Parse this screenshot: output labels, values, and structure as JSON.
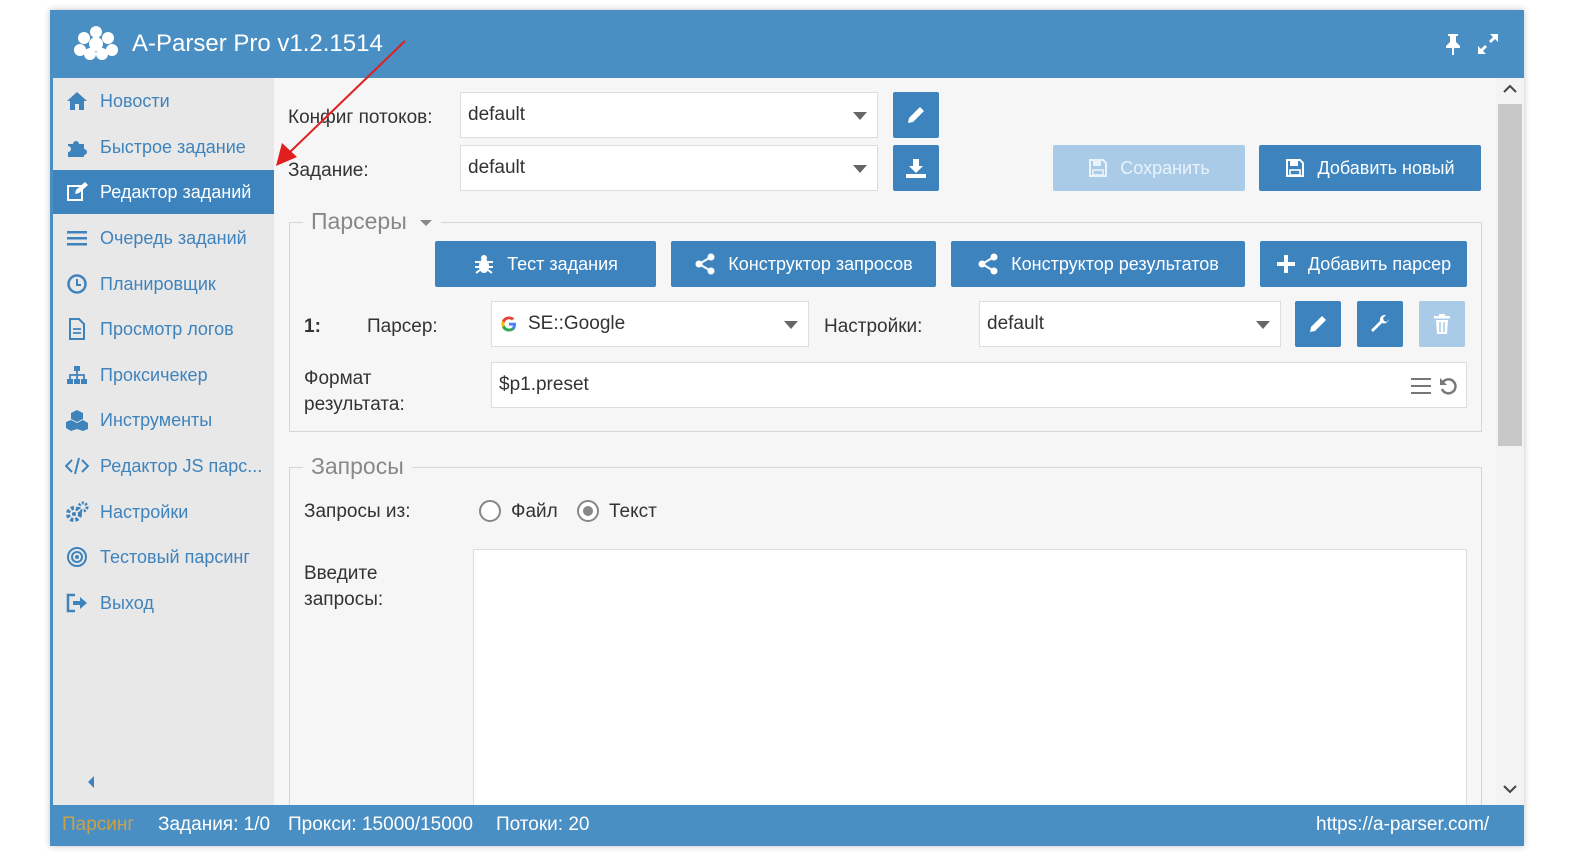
{
  "window": {
    "title": "A-Parser Pro v1.2.1514"
  },
  "sidebar": {
    "items": [
      {
        "label": "Новости",
        "icon": "home-icon"
      },
      {
        "label": "Быстрое задание",
        "icon": "puzzle-icon"
      },
      {
        "label": "Редактор заданий",
        "icon": "edit-icon",
        "active": true
      },
      {
        "label": "Очередь заданий",
        "icon": "list-icon"
      },
      {
        "label": "Планировщик",
        "icon": "clock-icon"
      },
      {
        "label": "Просмотр логов",
        "icon": "file-icon"
      },
      {
        "label": "Проксичекер",
        "icon": "sitemap-icon"
      },
      {
        "label": "Инструменты",
        "icon": "cubes-icon"
      },
      {
        "label": "Редактор JS парс...",
        "icon": "code-icon"
      },
      {
        "label": "Настройки",
        "icon": "gears-icon"
      },
      {
        "label": "Тестовый парсинг",
        "icon": "target-icon"
      },
      {
        "label": "Выход",
        "icon": "sign-out-icon"
      }
    ]
  },
  "form": {
    "threads_config_label": "Конфиг потоков:",
    "threads_config_value": "default",
    "task_label": "Задание:",
    "task_value": "default",
    "save_label": "Сохранить",
    "add_new_label": "Добавить новый"
  },
  "parsers": {
    "legend": "Парсеры",
    "test_task_label": "Тест задания",
    "query_builder_label": "Конструктор запросов",
    "result_builder_label": "Конструктор результатов",
    "add_parser_label": "Добавить парсер",
    "row_index": "1:",
    "parser_label": "Парсер:",
    "parser_value": "SE::Google",
    "settings_label": "Настройки:",
    "settings_value": "default",
    "result_format_label_1": "Формат",
    "result_format_label_2": "результата:",
    "result_format_value": "$p1.preset"
  },
  "queries": {
    "legend": "Запросы",
    "source_label": "Запросы из:",
    "option_file": "Файл",
    "option_text": "Текст",
    "selected": "Текст",
    "enter_label_1": "Введите",
    "enter_label_2": "запросы:",
    "value": ""
  },
  "status": {
    "mode": "Парсинг",
    "tasks": "Задания: 1/0",
    "proxies": "Прокси: 15000/15000",
    "threads": "Потоки: 20",
    "url": "https://a-parser.com/"
  },
  "colors": {
    "accent": "#3d84bf",
    "titlebar": "#4a8fc3",
    "disabled": "#a9cbe8",
    "annotation_arrow": "#e02020"
  }
}
